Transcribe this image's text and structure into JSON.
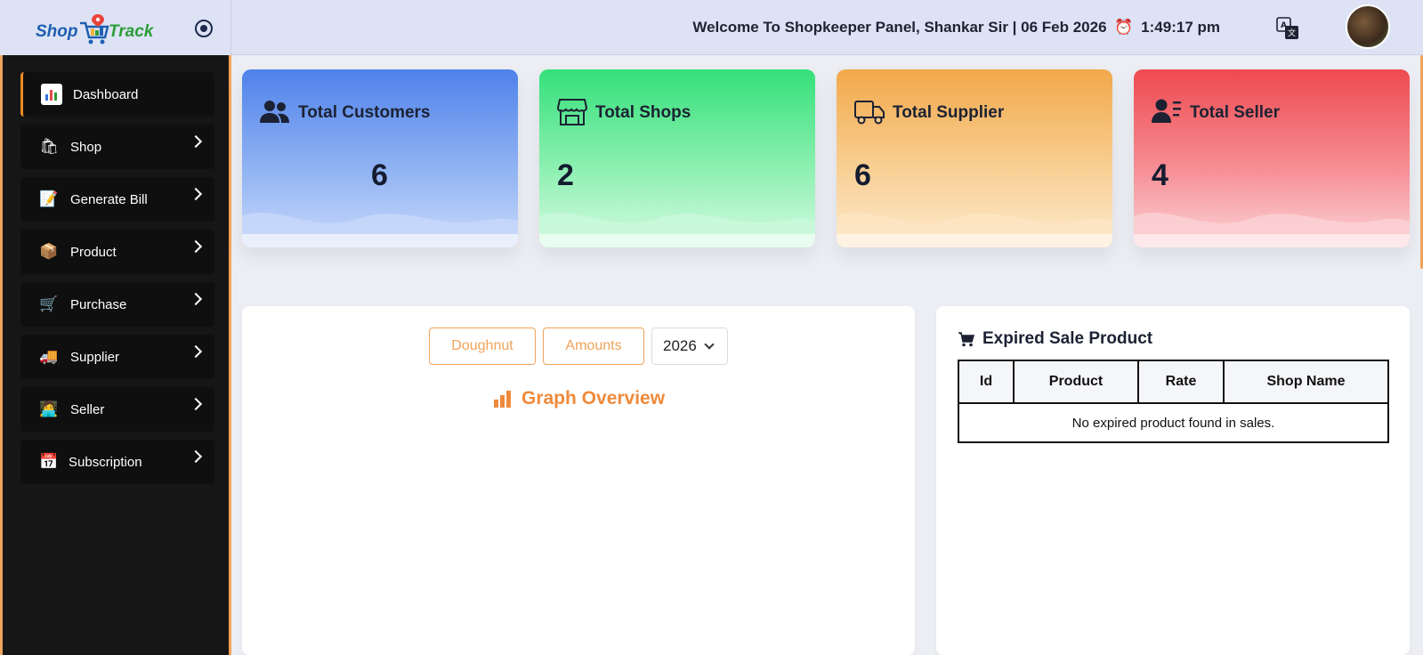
{
  "header": {
    "logo": {
      "part1": "Shop",
      "part2": "Track"
    },
    "welcome_text": "Welcome To Shopkeeper Panel, Shankar Sir | 06 Feb 2026",
    "clock_icon": "alarm-clock-icon",
    "time": "1:49:17 pm",
    "translate_icon": "translate-icon"
  },
  "sidebar": {
    "items": [
      {
        "label": "Dashboard",
        "icon": "chart-icon",
        "active": true
      },
      {
        "label": "Shop",
        "icon": "shopping-bags-icon"
      },
      {
        "label": "Generate Bill",
        "icon": "memo-icon"
      },
      {
        "label": "Product",
        "icon": "package-icon"
      },
      {
        "label": "Purchase",
        "icon": "cart-icon"
      },
      {
        "label": "Supplier",
        "icon": "truck-icon"
      },
      {
        "label": "Seller",
        "icon": "seller-icon"
      },
      {
        "label": "Subscription",
        "icon": "calendar-icon"
      }
    ]
  },
  "cards": [
    {
      "title": "Total Customers",
      "value": "6",
      "icon": "users-icon",
      "color": "#4f82ea"
    },
    {
      "title": "Total Shops",
      "value": "2",
      "icon": "store-icon",
      "color": "#34e07a"
    },
    {
      "title": "Total Supplier",
      "value": "6",
      "icon": "truck-icon",
      "color": "#f2a84a"
    },
    {
      "title": "Total Seller",
      "value": "4",
      "icon": "user-list-icon",
      "color": "#ee4a50"
    }
  ],
  "graph_panel": {
    "doughnut_label": "Doughnut",
    "amounts_label": "Amounts",
    "year": "2026",
    "title": "Graph Overview"
  },
  "expired_panel": {
    "title": "Expired Sale Product",
    "columns": [
      "Id",
      "Product",
      "Rate",
      "Shop Name"
    ],
    "empty_message": "No expired product found in sales."
  }
}
